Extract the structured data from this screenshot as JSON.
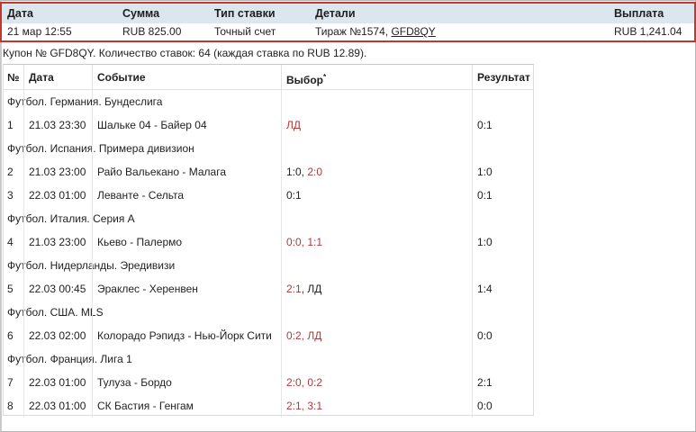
{
  "bet_table": {
    "headers": [
      "Дата",
      "Сумма",
      "Тип ставки",
      "Детали",
      "Выплата"
    ],
    "row": {
      "date": "21 мар 12:55",
      "amount": "RUB 825.00",
      "bet_type": "Точный счет",
      "details_text": "Тираж №1574, ",
      "details_link": "GFD8QY",
      "payout": "RUB 1,241.04"
    }
  },
  "coupon": {
    "text": "Купон № GFD8QY. Количество ставок: 64 (каждая ставка по RUB 12.89)."
  },
  "events_table": {
    "headers": {
      "num": "№",
      "date": "Дата",
      "event": "Событие",
      "pick": "Выбор",
      "pick_sup": "*",
      "result": "Результат"
    },
    "groups": [
      {
        "league": "Футбол. Германия. Бундеслига",
        "rows": [
          {
            "num": "1",
            "date": "21.03 23:30",
            "event": "Шальке 04 - Байер 04",
            "pick": [
              {
                "t": "ЛД",
                "red": true
              }
            ],
            "result": "0:1"
          }
        ]
      },
      {
        "league": "Футбол. Испания. Примера дивизион",
        "rows": [
          {
            "num": "2",
            "date": "21.03 23:00",
            "event": "Райо Вальекано - Малага",
            "pick": [
              {
                "t": "1:0, ",
                "red": false
              },
              {
                "t": "2:0",
                "red": true
              }
            ],
            "result": "1:0"
          },
          {
            "num": "3",
            "date": "22.03 01:00",
            "event": "Леванте - Сельта",
            "pick": [
              {
                "t": "0:1",
                "red": false
              }
            ],
            "result": "0:1"
          }
        ]
      },
      {
        "league": "Футбол. Италия. Серия А",
        "rows": [
          {
            "num": "4",
            "date": "21.03 23:00",
            "event": "Кьево - Палермо",
            "pick": [
              {
                "t": "0:0, 1:1",
                "red": true
              }
            ],
            "result": "1:0"
          }
        ]
      },
      {
        "league": "Футбол. Нидерланды. Эредивизи",
        "rows": [
          {
            "num": "5",
            "date": "22.03 00:45",
            "event": "Эраклес - Херенвен",
            "pick": [
              {
                "t": "2:1",
                "red": true
              },
              {
                "t": ", ЛД",
                "red": false
              }
            ],
            "result": "1:4"
          }
        ]
      },
      {
        "league": "Футбол. США. MLS",
        "rows": [
          {
            "num": "6",
            "date": "22.03 02:00",
            "event": "Колорадо Рэпидз - Нью-Йорк Сити",
            "pick": [
              {
                "t": "0:2, ЛД",
                "red": true
              }
            ],
            "result": "0:0"
          }
        ]
      },
      {
        "league": "Футбол. Франция. Лига 1",
        "rows": [
          {
            "num": "7",
            "date": "22.03 01:00",
            "event": "Тулуза - Бордо",
            "pick": [
              {
                "t": "2:0, 0:2",
                "red": true
              }
            ],
            "result": "2:1"
          },
          {
            "num": "8",
            "date": "22.03 01:00",
            "event": "СК Бастия - Генгам",
            "pick": [
              {
                "t": "2:1, 3:1",
                "red": true
              }
            ],
            "result": "0:0"
          }
        ]
      }
    ]
  },
  "colors": {
    "header_bg": "#dbe6ef",
    "highlight_border": "#c0392b",
    "pick_red": "#b03a3a",
    "link": "#1a4c8c"
  }
}
